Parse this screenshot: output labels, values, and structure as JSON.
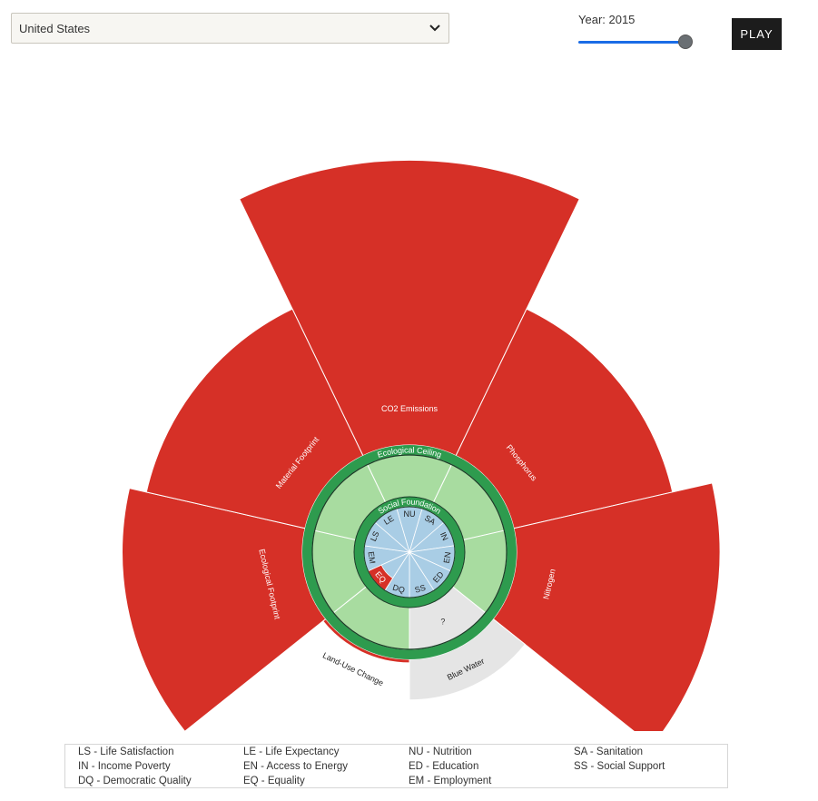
{
  "country": {
    "selected": "United States"
  },
  "year": {
    "label": "Year: 2015",
    "value": 2015
  },
  "play_label": "PLAY",
  "chart_data": {
    "type": "doughnut",
    "ecological_ceiling_label": "Ecological Ceiling",
    "social_foundation_label": "Social Foundation",
    "ecological": [
      {
        "label": "CO2 Emissions",
        "ratio": 5.9,
        "color": "#d63027"
      },
      {
        "label": "Phosphorus",
        "ratio": 3.8,
        "color": "#d63027"
      },
      {
        "label": "Nitrogen",
        "ratio": 4.5,
        "color": "#d63027"
      },
      {
        "label": "Blue Water",
        "ratio": 1.7,
        "color": "#e5e5e5",
        "unknown_label": "?"
      },
      {
        "label": "Land-Use Change",
        "ratio": 1.06,
        "color": "#d63027"
      },
      {
        "label": "Ecological Footprint",
        "ratio": 4.1,
        "color": "#d63027"
      },
      {
        "label": "Material Footprint",
        "ratio": 3.8,
        "color": "#d63027"
      }
    ],
    "social": [
      "NU",
      "SA",
      "IN",
      "EN",
      "ED",
      "SS",
      "DQ",
      "EQ",
      "EM",
      "LS",
      "LE"
    ],
    "social_shortfall": [
      "EQ"
    ],
    "legend": [
      "LS - Life Satisfaction",
      "LE - Life Expectancy",
      "NU - Nutrition",
      "SA - Sanitation",
      "IN - Income Poverty",
      "EN - Access to Energy",
      "ED - Education",
      "SS - Social Support",
      "DQ - Democratic Quality",
      "EQ - Equality",
      "EM - Employment"
    ],
    "colors": {
      "overshoot": "#d63027",
      "unknown": "#e5e5e5",
      "eco_ring": "#2e9b4e",
      "eco_inner": "#a8dca0",
      "social_fill": "#a9cde5",
      "shortfall": "#d63027"
    }
  }
}
